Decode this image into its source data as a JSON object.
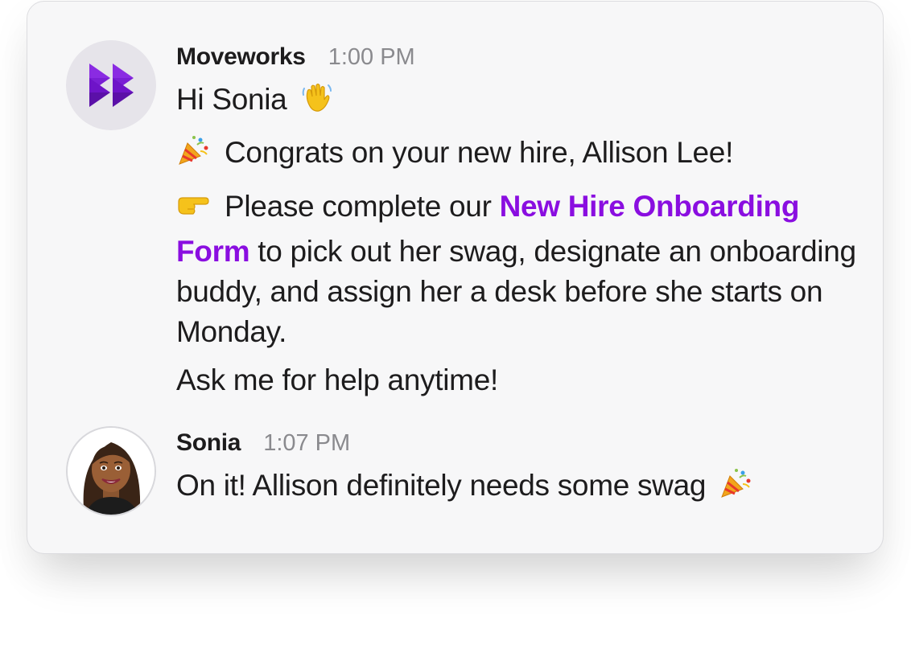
{
  "thread": {
    "messages": [
      {
        "sender": "Moveworks",
        "time": "1:00 PM",
        "avatar_icon": "moveworks-logo-icon",
        "greeting": "Hi Sonia",
        "greeting_emoji": "waving-hand-icon",
        "congrats": "Congrats on your new hire, Allison Lee!",
        "congrats_emoji": "party-popper-icon",
        "instruction_prefix": "Please complete our",
        "instruction_link": "New Hire Onboarding Form",
        "instruction_suffix": "to pick out her swag, designate an onboarding buddy, and assign her a desk before she starts on Monday.",
        "instruction_emoji": "pointing-right-icon",
        "closing": "Ask me for help anytime!"
      },
      {
        "sender": "Sonia",
        "time": "1:07 PM",
        "avatar_icon": "bitmoji-avatar-icon",
        "text": "On it! Allison definitely needs some swag",
        "text_emoji": "party-popper-icon"
      }
    ]
  },
  "colors": {
    "link": "#8a0ee0",
    "brand_purple": "#6e14c8",
    "card_background": "#f7f7f8",
    "text": "#1d1c1d",
    "timestamp": "#8a8a8e"
  }
}
